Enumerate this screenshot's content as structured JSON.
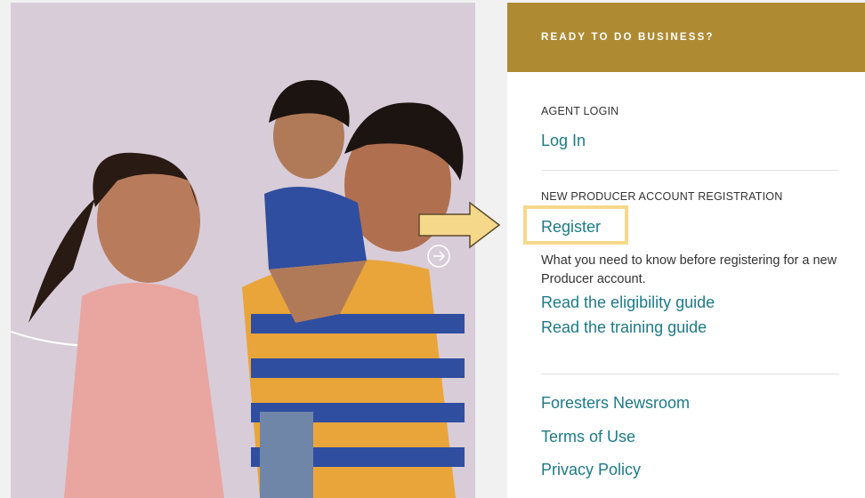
{
  "panel": {
    "header_title": "READY TO DO BUSINESS?",
    "agent_login": {
      "label": "AGENT LOGIN",
      "link": "Log In"
    },
    "registration": {
      "label": "NEW PRODUCER ACCOUNT REGISTRATION",
      "link": "Register",
      "info": "What you need to know before registering for a new Producer account.",
      "eligibility_link": "Read the eligibility guide",
      "training_link": "Read the training guide"
    },
    "footer_links": [
      "Foresters Newsroom",
      "Terms of Use",
      "Privacy Policy"
    ]
  },
  "colors": {
    "header_bg": "#ae8a33",
    "link": "#1d7a86",
    "highlight": "#f6d88a",
    "hero_bg": "#d8ccd8"
  },
  "icons": {
    "hero_arrow": "circle-arrow-right-icon",
    "annotation_arrow": "arrow-right-icon"
  }
}
